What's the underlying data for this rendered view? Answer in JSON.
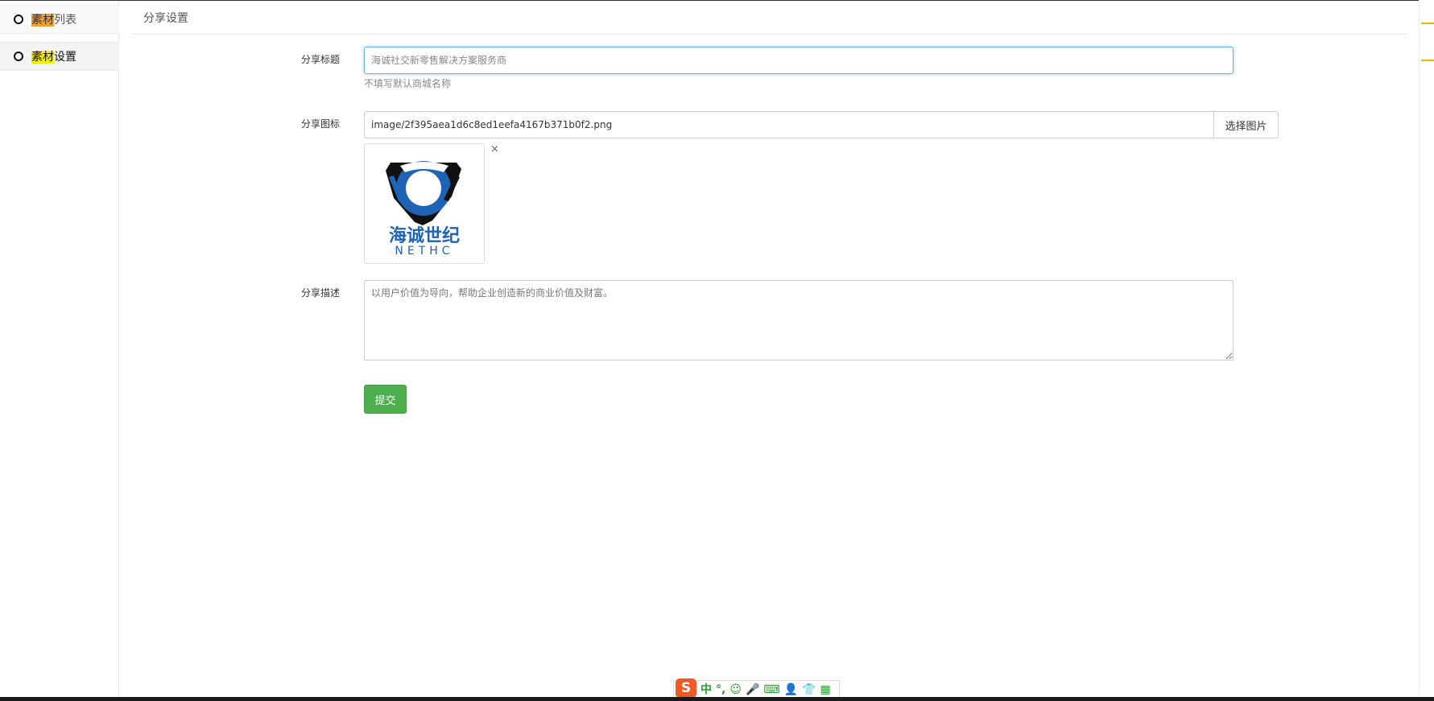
{
  "sidebar": {
    "items": [
      {
        "highlight": "素材",
        "rest": "列表"
      },
      {
        "highlight": "素材",
        "rest": "设置"
      }
    ]
  },
  "page": {
    "title": "分享设置"
  },
  "form": {
    "share_title_label": "分享标题",
    "share_title_placeholder": "海诚社交新零售解决方案服务商",
    "share_title_hint": "不填写默认商城名称",
    "share_icon_label": "分享图标",
    "share_icon_value": "image/2f395aea1d6c8ed1eefa4167b371b0f2.png",
    "pick_image_label": "选择图片",
    "remove_label": "×",
    "logo_text_cn": "海诚世纪",
    "logo_text_en": "NETHC",
    "share_desc_label": "分享描述",
    "share_desc_placeholder": "以用户价值为导向，帮助企业创造新的商业价值及财富。",
    "submit_label": "提交"
  },
  "ime": {
    "logo": "S",
    "items": [
      "中",
      "°,",
      "☺",
      "🎤",
      "⌨",
      "👤",
      "👕",
      "▦"
    ]
  },
  "colors": {
    "accent_green": "#4cae4c",
    "focus_blue": "#66afe9",
    "logo_blue": "#1f63b6",
    "highlight_orange": "#f0a030",
    "highlight_yellow": "#f5ef00"
  }
}
